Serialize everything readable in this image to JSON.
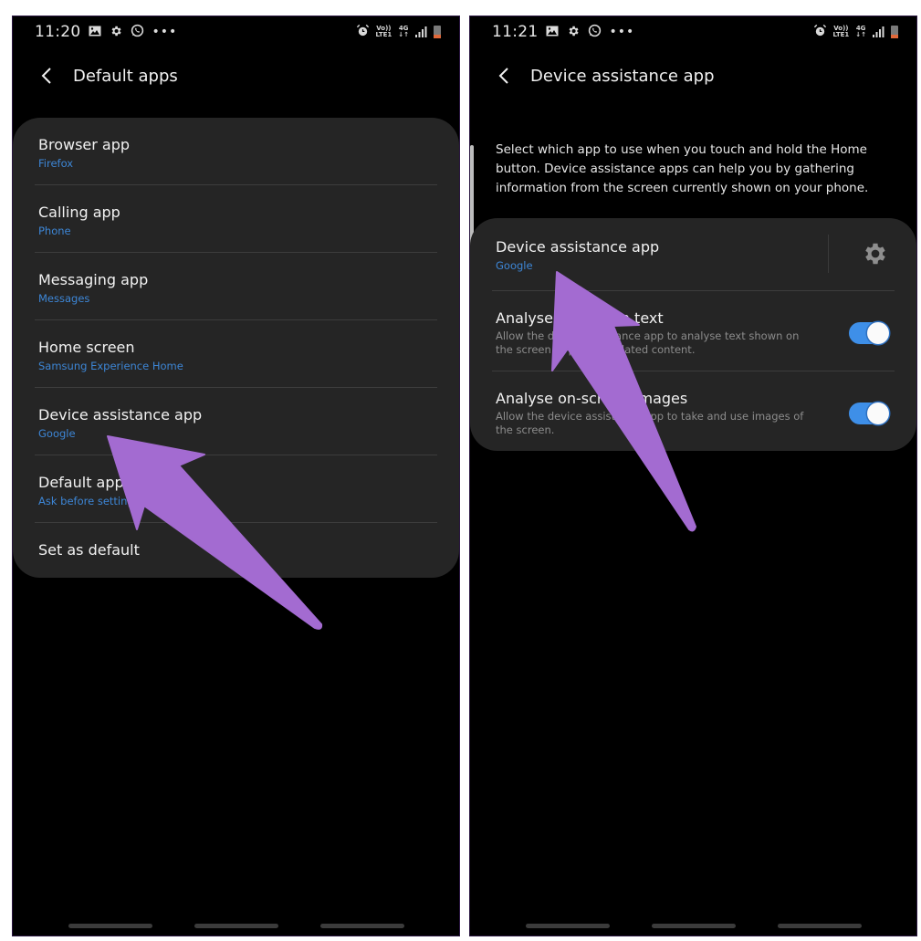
{
  "left_screen": {
    "status": {
      "time": "11:20",
      "left_icons": [
        "gallery-icon",
        "gear-icon",
        "whatsapp-icon",
        "more-dots-icon"
      ],
      "right_icons": [
        "alarm-icon",
        "volte-lte-icon",
        "4g-data-icon",
        "signal-icon",
        "battery-low-icon"
      ],
      "volte_top": "Vo))",
      "volte_bottom": "LTE1",
      "network_top": "4G",
      "network_bottom": "↓↑"
    },
    "header": {
      "title": "Default apps"
    },
    "items": [
      {
        "label": "Browser app",
        "value": "Firefox"
      },
      {
        "label": "Calling app",
        "value": "Phone"
      },
      {
        "label": "Messaging app",
        "value": "Messages"
      },
      {
        "label": "Home screen",
        "value": "Samsung Experience Home"
      },
      {
        "label": "Device assistance app",
        "value": "Google"
      },
      {
        "label": "Default app",
        "value": "Ask before setting"
      },
      {
        "label": "Set as default"
      }
    ]
  },
  "right_screen": {
    "status": {
      "time": "11:21",
      "left_icons": [
        "gallery-icon",
        "gear-icon",
        "whatsapp-icon",
        "more-dots-icon"
      ],
      "right_icons": [
        "alarm-icon",
        "volte-lte-icon",
        "4g-data-icon",
        "signal-icon",
        "battery-low-icon"
      ],
      "volte_top": "Vo))",
      "volte_bottom": "LTE1",
      "network_top": "4G",
      "network_bottom": "↓↑"
    },
    "header": {
      "title": "Device assistance app"
    },
    "intro": "Select which app to use when you touch and hold the Home button. Device assistance apps can help you by gathering information from the screen currently shown on your phone.",
    "assist_app": {
      "label": "Device assistance app",
      "value": "Google"
    },
    "toggles": [
      {
        "label": "Analyse on-screen text",
        "desc": "Allow the device assistance app to analyse text shown on the screen to provide related content.",
        "on": true
      },
      {
        "label": "Analyse on-screen images",
        "desc": "Allow the device assistance app to take and use images of the screen.",
        "on": true
      }
    ]
  },
  "annotation": {
    "arrow_color": "#a36bd1"
  },
  "colors": {
    "accent_blue": "#3d86d6",
    "toggle_on": "#3e8fe8",
    "card_bg": "#252525"
  }
}
